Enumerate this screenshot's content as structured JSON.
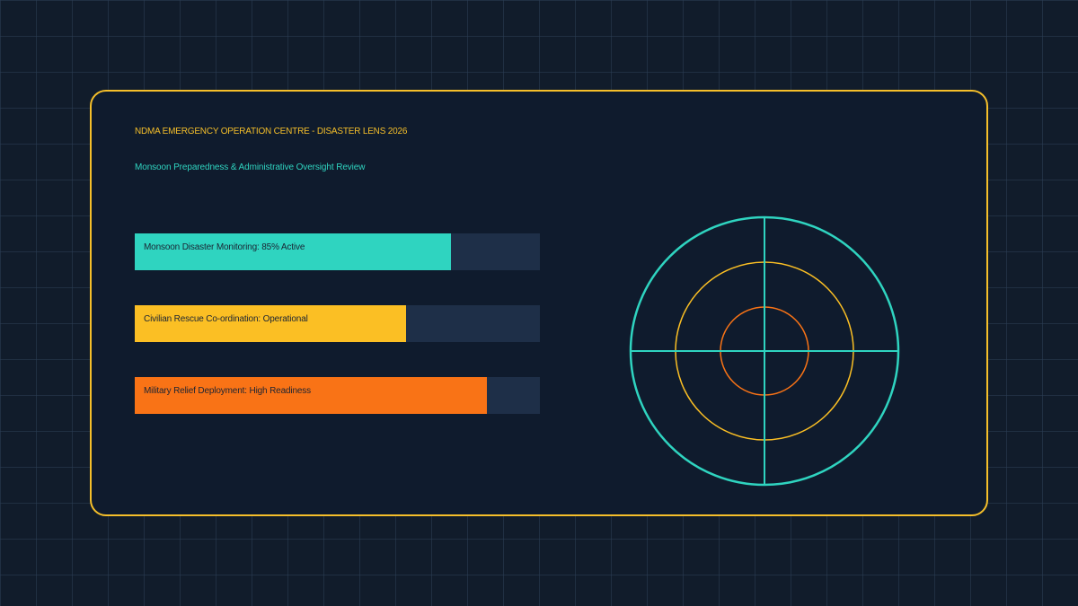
{
  "panel": {
    "title": "NDMA EMERGENCY OPERATION CENTRE - DISASTER LENS 2026",
    "subtitle": "Monsoon Preparedness & Administrative Oversight Review"
  },
  "status_bars": [
    {
      "label": "Monsoon Disaster Monitoring: 85% Active",
      "fill_percent": 78,
      "color": "#2fd4c0"
    },
    {
      "label": "Civilian Rescue Co-ordination: Operational",
      "fill_percent": 67,
      "color": "#fbbf24"
    },
    {
      "label": "Military Relief Deployment: High Readiness",
      "fill_percent": 87,
      "color": "#f97316"
    }
  ],
  "radar": {
    "outer_color": "#2fd4c0",
    "middle_color": "#fbbf24",
    "inner_color": "#f97316",
    "crosshair_color": "#2fd4c0"
  },
  "theme": {
    "border": "#f5bf2a",
    "track": "#1e2f48"
  }
}
